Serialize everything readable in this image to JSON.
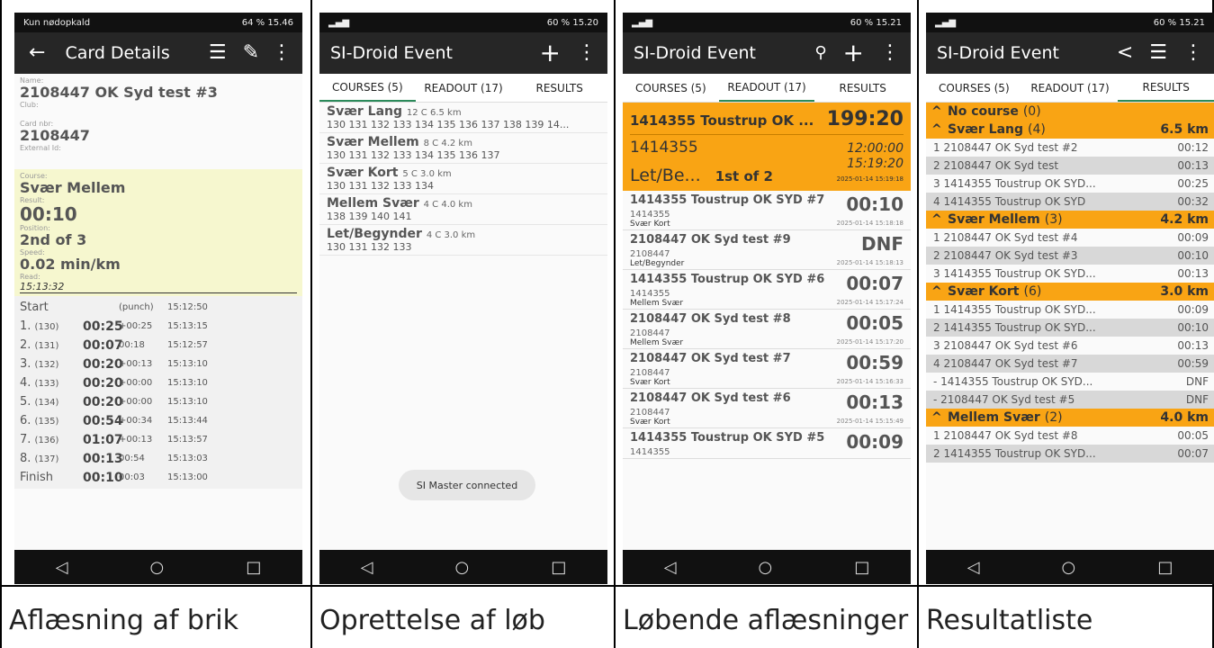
{
  "captions": [
    "Aflæsning af brik",
    "Oprettelse af løb",
    "Løbende aflæsninger",
    "Resultatliste"
  ],
  "p1": {
    "status_left": "Kun nødopkald",
    "status_right": "64 %  15.46",
    "title": "Card Details",
    "back_icon": "arrow-left",
    "name_lbl": "Name:",
    "name": "2108447 OK Syd test #3",
    "club_lbl": "Club:",
    "card_lbl": "Card nbr:",
    "card": "2108447",
    "ext_lbl": "External Id:",
    "course_lbl": "Course:",
    "course": "Svær Mellem",
    "result_lbl": "Result:",
    "result": "00:10",
    "pos_lbl": "Position:",
    "pos": "2nd of 3",
    "speed_lbl": "Speed:",
    "speed": "0.02 min/km",
    "read_lbl": "Read:",
    "read": "15:13:32",
    "start": {
      "label": "Start",
      "split": "(punch)",
      "time": "15:12:50"
    },
    "punches": [
      {
        "n": "1.",
        "code": "(130)",
        "split": "00:25",
        "diff": "+00:25",
        "time": "15:13:15"
      },
      {
        "n": "2.",
        "code": "(131)",
        "split": "00:07",
        "diff": "00:18",
        "time": "15:12:57"
      },
      {
        "n": "3.",
        "code": "(132)",
        "split": "00:20",
        "diff": "+00:13",
        "time": "15:13:10"
      },
      {
        "n": "4.",
        "code": "(133)",
        "split": "00:20",
        "diff": "+00:00",
        "time": "15:13:10"
      },
      {
        "n": "5.",
        "code": "(134)",
        "split": "00:20",
        "diff": "+00:00",
        "time": "15:13:10"
      },
      {
        "n": "6.",
        "code": "(135)",
        "split": "00:54",
        "diff": "+00:34",
        "time": "15:13:44"
      },
      {
        "n": "7.",
        "code": "(136)",
        "split": "01:07",
        "diff": "+00:13",
        "time": "15:13:57"
      },
      {
        "n": "8.",
        "code": "(137)",
        "split": "00:13",
        "diff": "00:54",
        "time": "15:13:03"
      }
    ],
    "finish": {
      "label": "Finish",
      "split": "00:10",
      "diff": "00:03",
      "time": "15:13:00"
    }
  },
  "p2": {
    "status_right": "60 %  15.20",
    "title": "SI-Droid Event",
    "tabs": [
      "COURSES (5)",
      "READOUT (17)",
      "RESULTS"
    ],
    "courses": [
      {
        "name": "Svær Lang",
        "meta": "12 C 6.5 km",
        "codes": "130 131 132 133 134 135 136 137 138 139 14..."
      },
      {
        "name": "Svær Mellem",
        "meta": "8 C 4.2 km",
        "codes": "130 131 132 133 134 135 136 137"
      },
      {
        "name": "Svær Kort",
        "meta": "5 C 3.0 km",
        "codes": "130 131 132 133 134"
      },
      {
        "name": "Mellem Svær",
        "meta": "4 C 4.0 km",
        "codes": "138 139 140 141"
      },
      {
        "name": "Let/Begynder",
        "meta": "4 C 3.0 km",
        "codes": "130 131 132 133"
      }
    ],
    "toast": "SI Master connected"
  },
  "p3": {
    "status_right": "60 %  15.21",
    "title": "SI-Droid Event",
    "tabs": [
      "COURSES (5)",
      "READOUT (17)",
      "RESULTS"
    ],
    "latest": {
      "name": "1414355 Toustrup OK ...",
      "result": "199:20",
      "card": "1414355",
      "start": "12:00:00",
      "finish": "15:19:20",
      "course": "Let/Be...",
      "pos": "1st of 2",
      "date": "2025-01-14 15:19:18"
    },
    "readouts": [
      {
        "name": "1414355 Toustrup OK SYD #7",
        "time": "00:10",
        "card": "1414355",
        "course": "Svær Kort",
        "date": "2025-01-14 15:18:18"
      },
      {
        "name": "2108447 OK Syd test #9",
        "time": "DNF",
        "card": "2108447",
        "course": "Let/Begynder",
        "date": "2025-01-14 15:18:13"
      },
      {
        "name": "1414355 Toustrup OK SYD #6",
        "time": "00:07",
        "card": "1414355",
        "course": "Mellem Svær",
        "date": "2025-01-14 15:17:24"
      },
      {
        "name": "2108447 OK Syd test #8",
        "time": "00:05",
        "card": "2108447",
        "course": "Mellem Svær",
        "date": "2025-01-14 15:17:20"
      },
      {
        "name": "2108447 OK Syd test #7",
        "time": "00:59",
        "card": "2108447",
        "course": "Svær Kort",
        "date": "2025-01-14 15:16:33"
      },
      {
        "name": "2108447 OK Syd test #6",
        "time": "00:13",
        "card": "2108447",
        "course": "Svær Kort",
        "date": "2025-01-14 15:15:49"
      },
      {
        "name": "1414355 Toustrup OK SYD #5",
        "time": "00:09",
        "card": "1414355",
        "course": "",
        "date": ""
      }
    ]
  },
  "p4": {
    "status_right": "60 %  15.21",
    "title": "SI-Droid Event",
    "tabs": [
      "COURSES (5)",
      "READOUT (17)",
      "RESULTS"
    ],
    "groups": [
      {
        "name": "No course",
        "count": "(0)",
        "km": "",
        "rows": []
      },
      {
        "name": "Svær Lang",
        "count": "(4)",
        "km": "6.5 km",
        "rows": [
          {
            "text": "1 2108447 OK Syd test #2",
            "time": "00:12"
          },
          {
            "text": "2 2108447 OK Syd test",
            "time": "00:13"
          },
          {
            "text": "3 1414355 Toustrup OK SYD...",
            "time": "00:25"
          },
          {
            "text": "4 1414355 Toustrup OK SYD",
            "time": "00:32"
          }
        ]
      },
      {
        "name": "Svær Mellem",
        "count": "(3)",
        "km": "4.2 km",
        "rows": [
          {
            "text": "1 2108447 OK Syd test #4",
            "time": "00:09"
          },
          {
            "text": "2 2108447 OK Syd test #3",
            "time": "00:10"
          },
          {
            "text": "3 1414355 Toustrup OK SYD...",
            "time": "00:13"
          }
        ]
      },
      {
        "name": "Svær Kort",
        "count": "(6)",
        "km": "3.0 km",
        "rows": [
          {
            "text": "1 1414355 Toustrup OK SYD...",
            "time": "00:09"
          },
          {
            "text": "2 1414355 Toustrup OK SYD...",
            "time": "00:10"
          },
          {
            "text": "3 2108447 OK Syd test #6",
            "time": "00:13"
          },
          {
            "text": "4 2108447 OK Syd test #7",
            "time": "00:59"
          },
          {
            "text": "- 1414355 Toustrup OK SYD...",
            "time": "DNF"
          },
          {
            "text": "- 2108447 OK Syd test #5",
            "time": "DNF"
          }
        ]
      },
      {
        "name": "Mellem Svær",
        "count": "(2)",
        "km": "4.0 km",
        "rows": [
          {
            "text": "1 2108447 OK Syd test #8",
            "time": "00:05"
          },
          {
            "text": "2 1414355 Toustrup OK SYD...",
            "time": "00:07"
          }
        ]
      }
    ]
  },
  "nav": [
    "◁",
    "○",
    "□"
  ]
}
